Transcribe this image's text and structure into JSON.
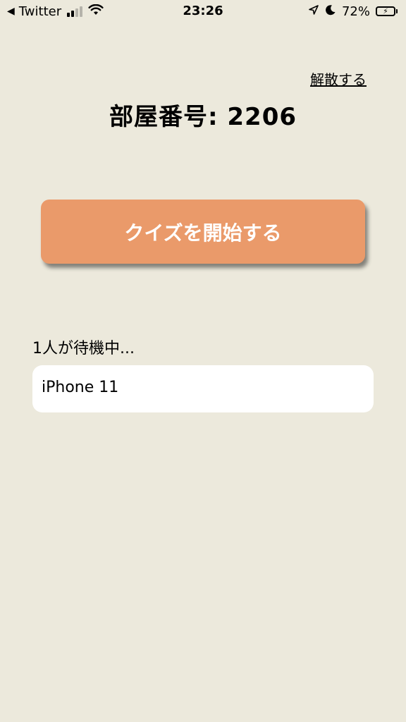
{
  "status_bar": {
    "back_app": "Twitter",
    "time": "23:26",
    "battery_percent": "72%",
    "battery_level": 0.72,
    "signal_bars_active": 2,
    "signal_bars_total": 4,
    "icons": [
      "back-arrow-icon",
      "cellular-signal-icon",
      "wifi-icon",
      "location-icon",
      "moon-icon",
      "battery-icon",
      "charging-bolt-icon"
    ]
  },
  "header": {
    "dissolve_label": "解散する",
    "room_title": "部屋番号:  2206"
  },
  "main": {
    "start_button_label": "クイズを開始する",
    "start_button_color": "#EA9A6A",
    "waiting_text": "1人が待機中...",
    "players": [
      "iPhone 11"
    ]
  },
  "colors": {
    "background": "#ECE9DC",
    "battery_green": "#34C759"
  }
}
